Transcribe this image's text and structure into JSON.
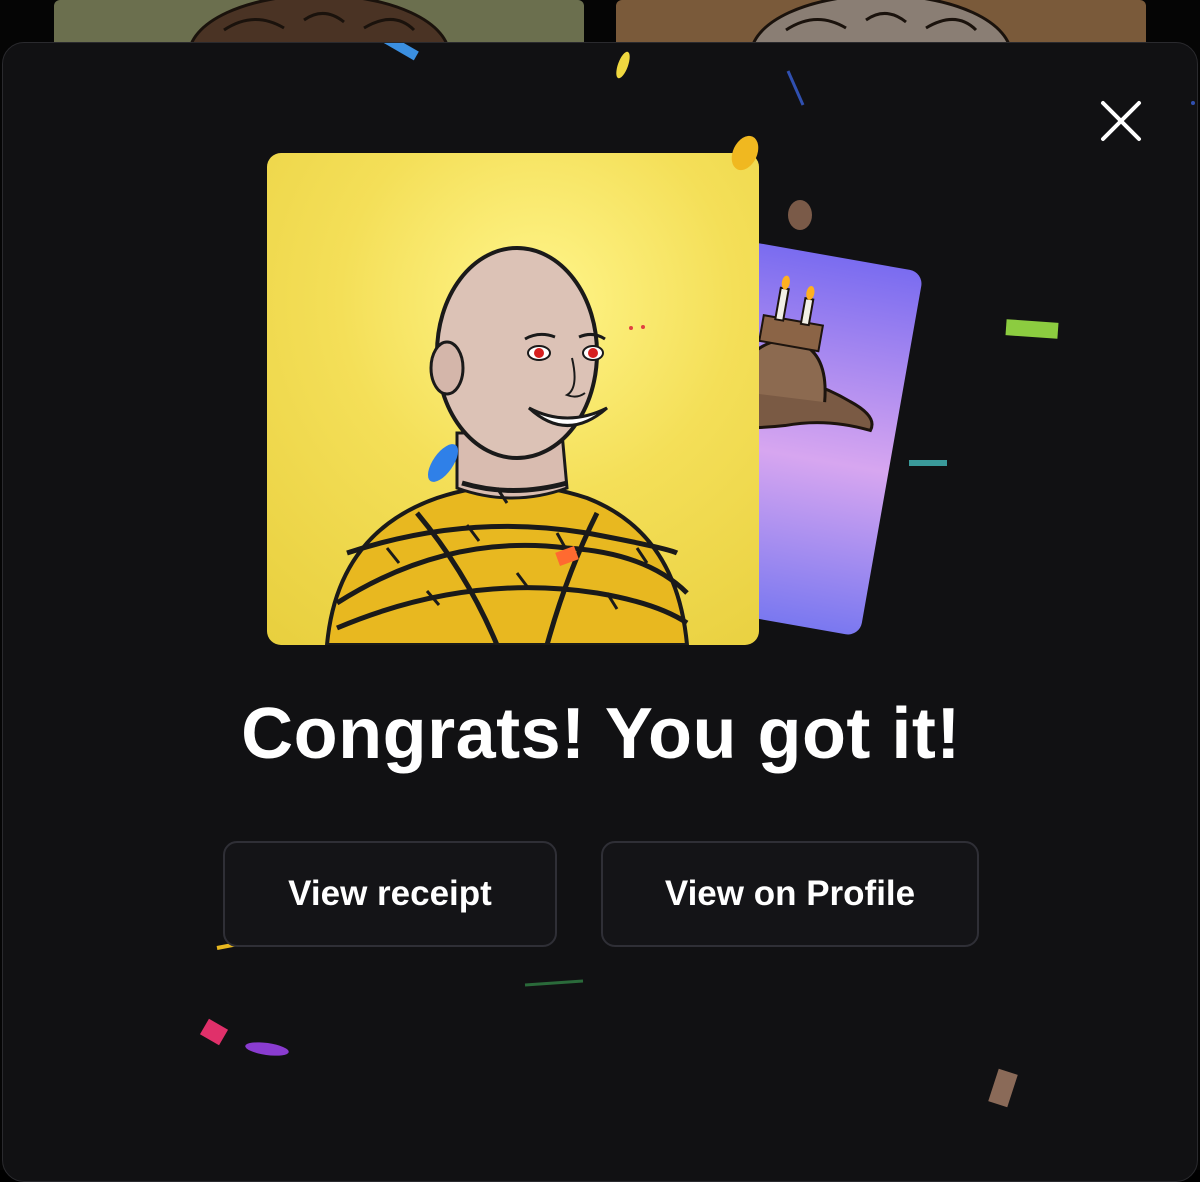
{
  "modal": {
    "title": "Congrats! You got it!",
    "close_icon": "close-icon",
    "buttons": {
      "view_receipt": "View receipt",
      "view_on_profile": "View on Profile"
    }
  },
  "artwork": {
    "front_card": "bald-character-barbed-wire-nft",
    "back_card": "cowboy-hat-cake-candles-nft"
  },
  "colors": {
    "modal_bg": "#111113",
    "button_bg": "#141417",
    "button_border": "#2f2f36",
    "text": "#ffffff",
    "front_card_bg": "#f4df58",
    "back_card_gradient_top": "#7a6cf0",
    "back_card_gradient_mid": "#d7a6f0"
  }
}
